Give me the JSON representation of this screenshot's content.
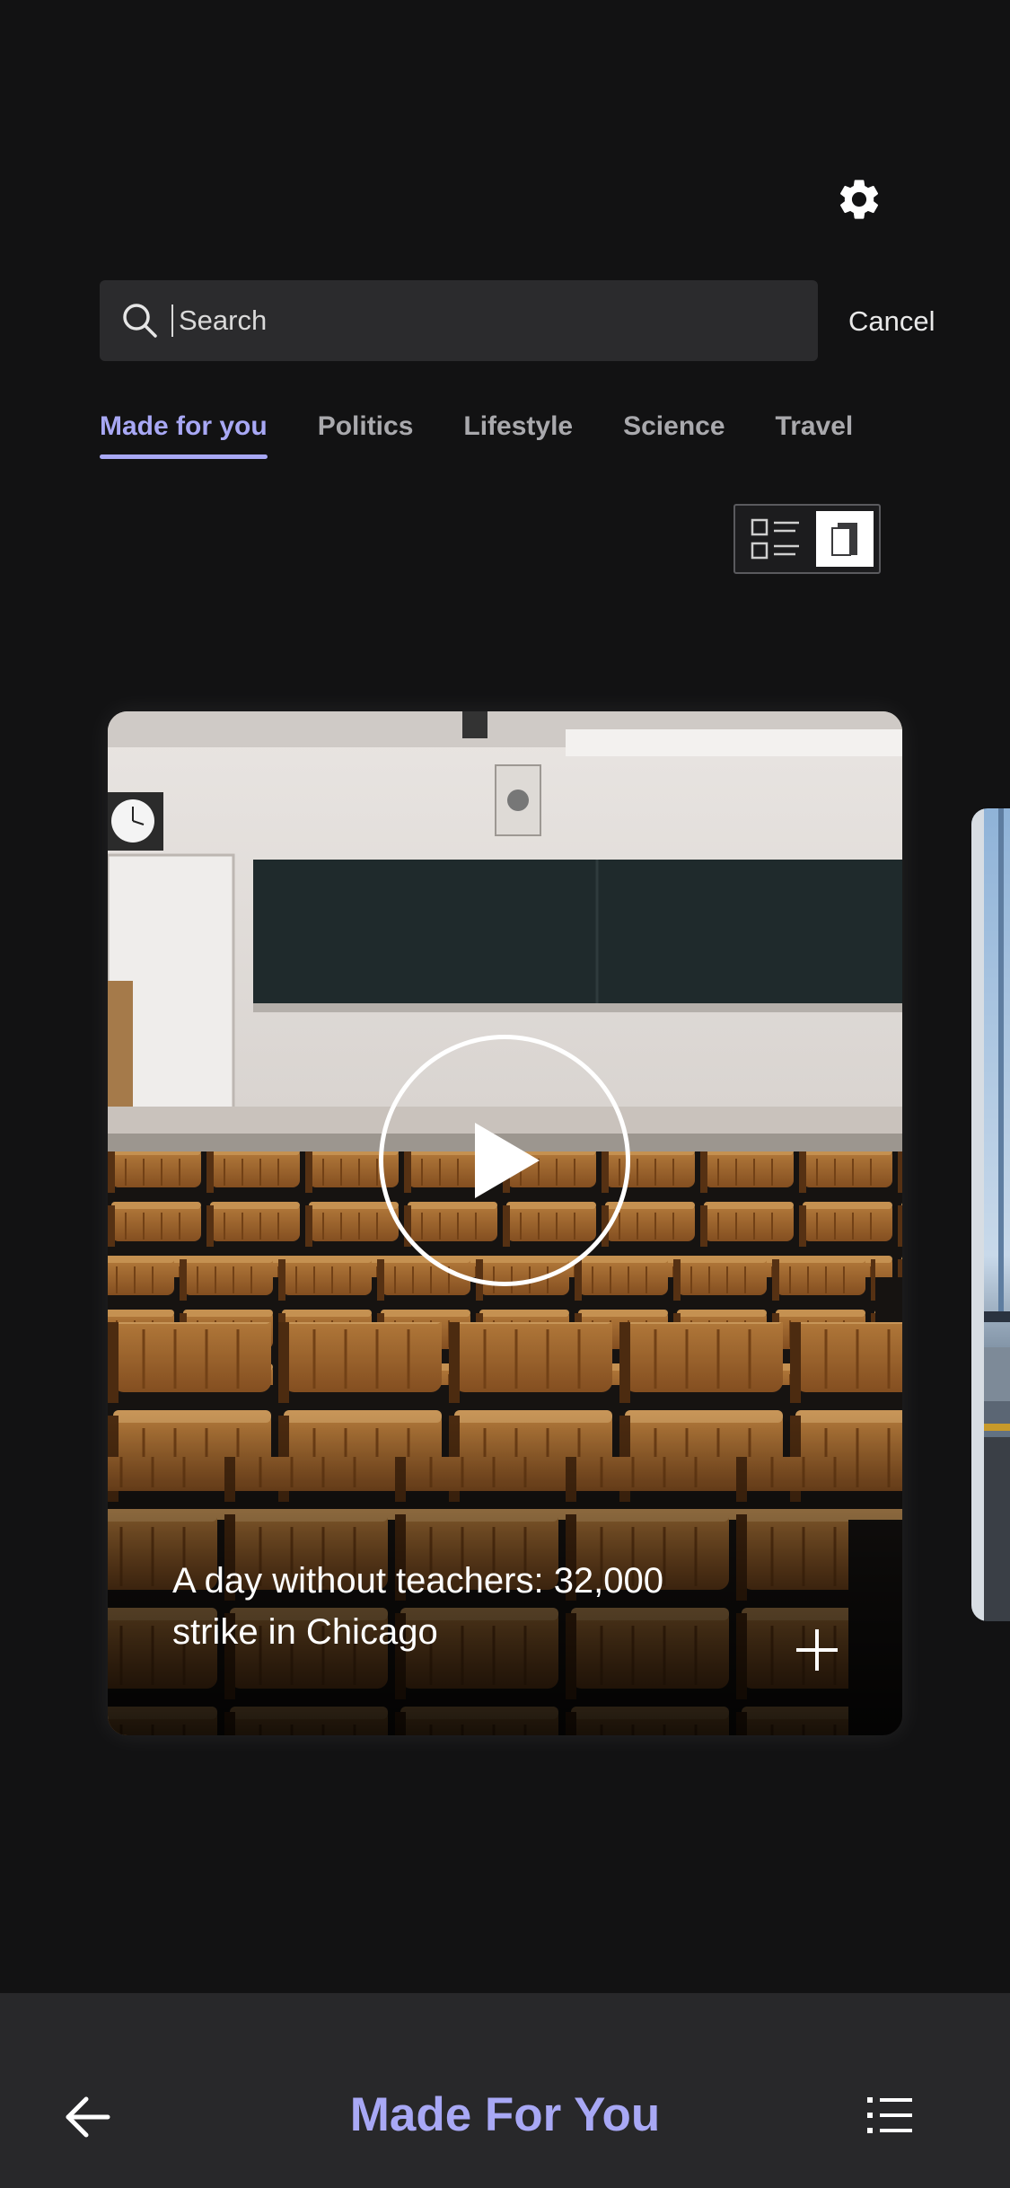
{
  "header": {
    "settings_icon": "gear-icon"
  },
  "search": {
    "placeholder": "Search",
    "value": "",
    "cancel_label": "Cancel",
    "icon": "search-icon"
  },
  "tabs": [
    {
      "label": "Made for you",
      "active": true
    },
    {
      "label": "Politics",
      "active": false
    },
    {
      "label": "Lifestyle",
      "active": false
    },
    {
      "label": "Science",
      "active": false
    },
    {
      "label": "Travel",
      "active": false
    }
  ],
  "view_toggle": {
    "options": [
      "list-view-icon",
      "card-view-icon"
    ],
    "selected": "card-view-icon"
  },
  "card": {
    "title": "A day without teachers: 32,000 strike in Chicago",
    "has_video": true,
    "play_icon": "play-icon",
    "add_icon": "plus-icon",
    "image_description_icon": "classroom-photo"
  },
  "bottom_bar": {
    "back_icon": "arrow-left-icon",
    "title": "Made For You",
    "menu_icon": "list-menu-icon"
  },
  "colors": {
    "background": "#121213",
    "accent": "#a8a8f5",
    "search_bg": "#2b2b2d",
    "bottom_bar_bg": "#28282a",
    "tab_inactive": "#a9a9ad"
  }
}
